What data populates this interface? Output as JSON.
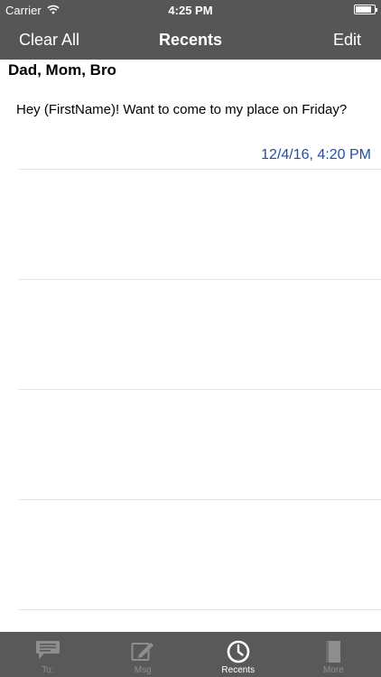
{
  "status_bar": {
    "carrier": "Carrier",
    "time": "4:25 PM",
    "battery_level": 0.85
  },
  "nav": {
    "left_label": "Clear All",
    "title": "Recents",
    "right_label": "Edit"
  },
  "recents": [
    {
      "recipients": "Dad, Mom, Bro",
      "message": "Hey (FirstName)! Want to come to my place on Friday?",
      "timestamp": "12/4/16, 4:20 PM"
    }
  ],
  "tabs": [
    {
      "label": "To:",
      "icon": "contact-card-icon",
      "active": false
    },
    {
      "label": "Msg",
      "icon": "compose-icon",
      "active": false
    },
    {
      "label": "Recents",
      "icon": "clock-icon",
      "active": true
    },
    {
      "label": "More",
      "icon": "book-icon",
      "active": false
    }
  ],
  "colors": {
    "bar_background": "#565656",
    "tab_background": "#595959",
    "timestamp": "#1e4fb4",
    "tab_inactive": "#8e8e8e",
    "tab_active": "#ffffff"
  }
}
